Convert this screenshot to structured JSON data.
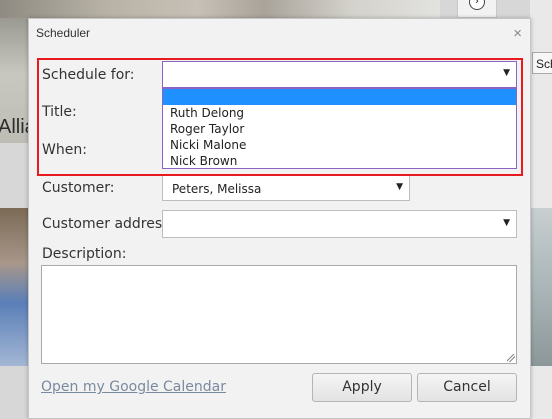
{
  "background": {
    "left_partial_text": "Allia",
    "right_partial_button": "Sch",
    "nav_icon": "chevron-right-icon",
    "nav_glyph": "›"
  },
  "dialog": {
    "title": "Scheduler",
    "close_glyph": "×",
    "schedule_for": {
      "label": "Schedule for:",
      "value": "",
      "arrow": "▼",
      "options": [
        "",
        "Ruth Delong",
        "Roger Taylor",
        "Nicki Malone",
        "Nick Brown"
      ],
      "highlighted_index": 0
    },
    "title_field": {
      "label": "Title:"
    },
    "when_field": {
      "label": "When:"
    },
    "customer": {
      "label": "Customer:",
      "value": "Peters, Melissa",
      "arrow": "▼"
    },
    "customer_address": {
      "label": "Customer address:",
      "value": "",
      "arrow": "▼"
    },
    "description": {
      "label": "Description:",
      "value": ""
    },
    "google_calendar_link": "Open my Google Calendar",
    "apply_label": "Apply",
    "cancel_label": "Cancel",
    "accent_color": "#1e90ff",
    "focus_border_color": "#8c62c2",
    "annotation_box_color": "#e8191f"
  }
}
